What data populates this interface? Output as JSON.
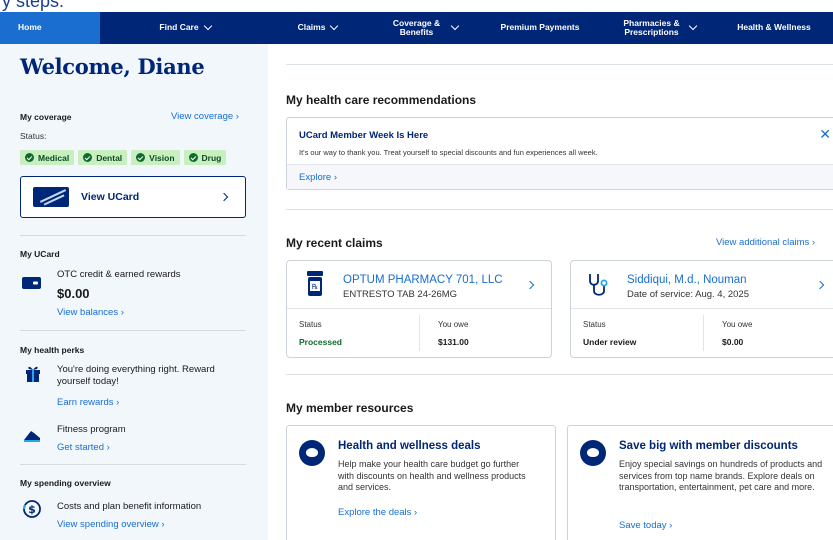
{
  "page_top_text": "y steps.",
  "nav": {
    "items": [
      {
        "label": "Home",
        "chevron": false
      },
      {
        "label": "Find Care",
        "chevron": true
      },
      {
        "label": "Claims",
        "chevron": true
      },
      {
        "label": "Coverage & Benefits",
        "chevron": true
      },
      {
        "label": "Premium Payments",
        "chevron": false
      },
      {
        "label": "Pharmacies & Prescriptions",
        "chevron": true
      },
      {
        "label": "Health & Wellness",
        "chevron": false
      }
    ]
  },
  "sidebar": {
    "welcome": "Welcome, Diane",
    "coverage": {
      "title": "My coverage",
      "link": "View coverage",
      "status_label": "Status:",
      "badges": [
        "Medical",
        "Dental",
        "Vision",
        "Drug"
      ],
      "ucard_button": "View UCard"
    },
    "ucard": {
      "title": "My UCard",
      "item": "OTC credit & earned rewards",
      "amount": "$0.00",
      "link": "View balances"
    },
    "perks": {
      "title": "My health perks",
      "item1": "You're doing everything right. Reward yourself today!",
      "link1": "Earn rewards",
      "item2": "Fitness program",
      "link2": "Get started"
    },
    "spending": {
      "title": "My spending overview",
      "item": "Costs and plan benefit information",
      "link": "View spending overview"
    }
  },
  "main": {
    "recommendations": {
      "heading": "My health care recommendations",
      "card_title": "UCard Member Week Is Here",
      "card_body": "It's our way to thank you. Treat yourself to special discounts and fun experiences all week.",
      "link": "Explore"
    },
    "claims": {
      "heading": "My recent claims",
      "link": "View additional claims",
      "items": [
        {
          "name": "OPTUM PHARMACY 701, LLC",
          "sub": "ENTRESTO TAB 24-26MG",
          "status_label": "Status",
          "status": "Processed",
          "owe_label": "You owe",
          "owe": "$131.00",
          "icon": "prescription-bottle-icon"
        },
        {
          "name": "Siddiqui, M.d., Nouman",
          "sub": "Date of service: Aug. 4, 2025",
          "status_label": "Status",
          "status": "Under review",
          "owe_label": "You owe",
          "owe": "$0.00",
          "icon": "stethoscope-icon"
        }
      ]
    },
    "resources": {
      "heading": "My member resources",
      "cards": [
        {
          "title": "Health and wellness deals",
          "body": "Help make your health care budget go further with discounts on health and wellness products and services.",
          "link": "Explore the deals"
        },
        {
          "title": "Save big with member discounts",
          "body": "Enjoy special savings on hundreds of products and services from top name brands. Explore deals on transportation, entertainment, pet care and more.",
          "link": "Save today"
        }
      ]
    }
  },
  "colors": {
    "nav_bg": "#002677",
    "nav_active": "#196ecf",
    "link": "#196ecf",
    "badge_bg": "#c9efc0",
    "processed": "#0f6b2d"
  }
}
